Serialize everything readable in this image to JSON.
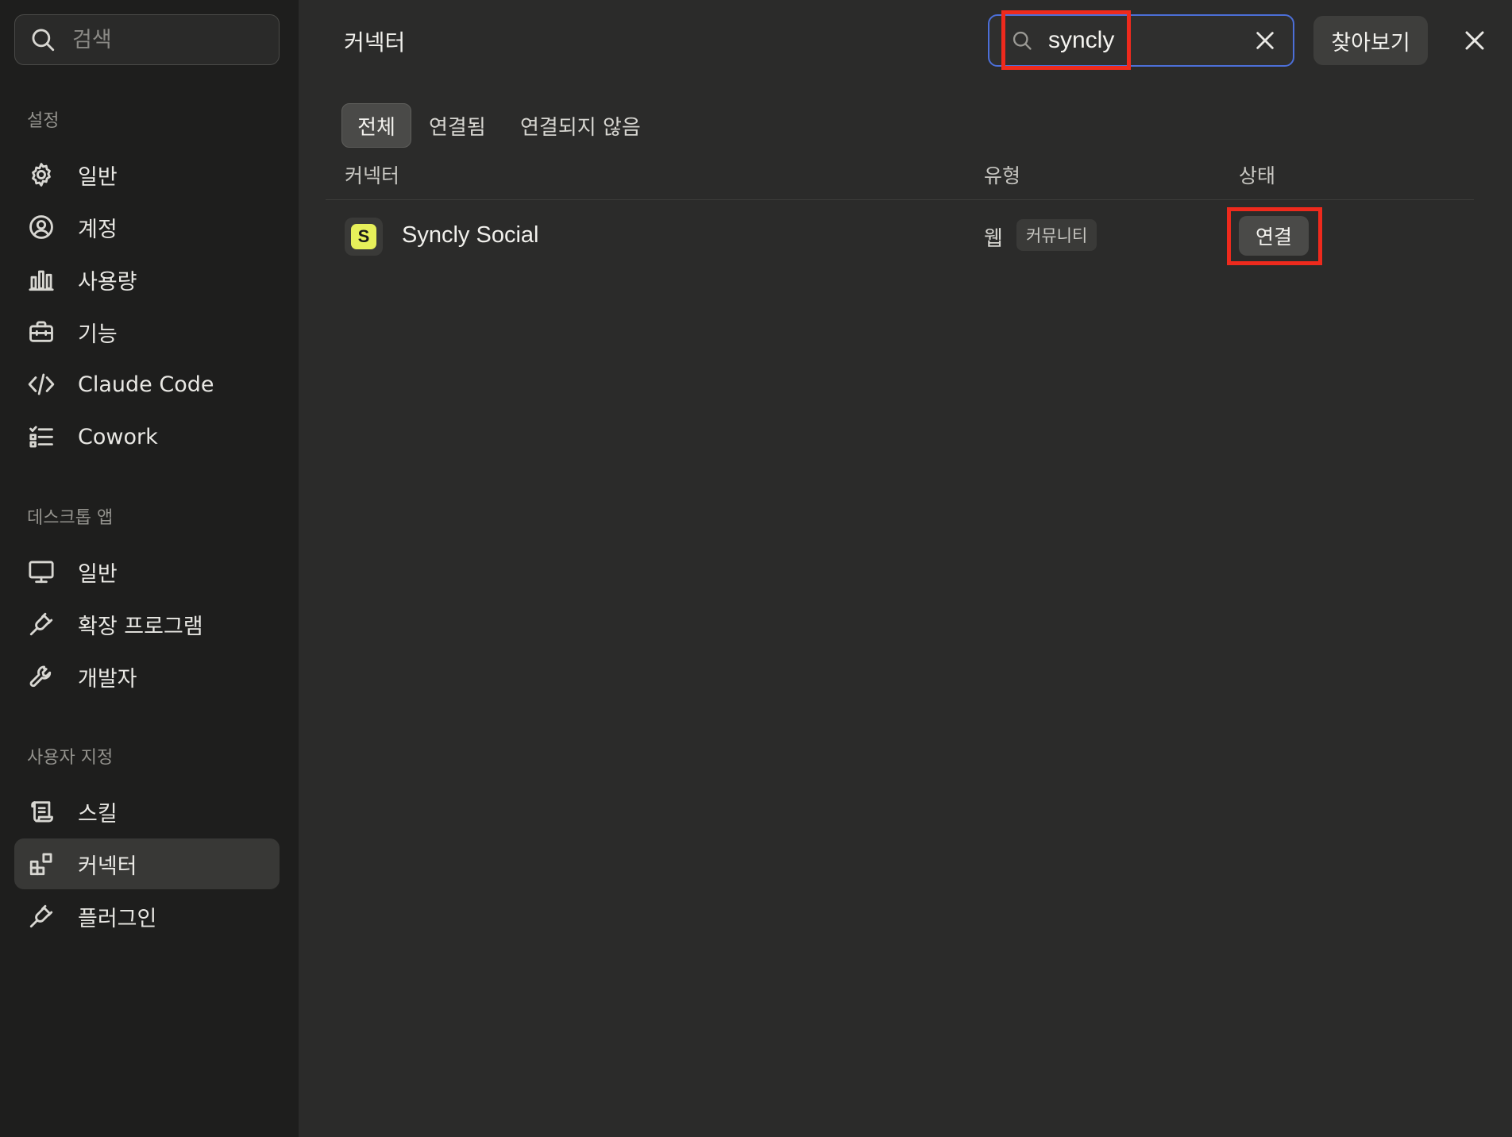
{
  "sidebar": {
    "search_placeholder": "검색",
    "sections": [
      {
        "title": "설정",
        "items": [
          {
            "label": "일반",
            "icon": "gear-icon"
          },
          {
            "label": "계정",
            "icon": "user-circle-icon"
          },
          {
            "label": "사용량",
            "icon": "bar-chart-icon"
          },
          {
            "label": "기능",
            "icon": "briefcase-icon"
          },
          {
            "label": "Claude Code",
            "icon": "code-icon"
          },
          {
            "label": "Cowork",
            "icon": "checklist-icon"
          }
        ]
      },
      {
        "title": "데스크톱 앱",
        "items": [
          {
            "label": "일반",
            "icon": "monitor-icon"
          },
          {
            "label": "확장 프로그램",
            "icon": "plug-icon"
          },
          {
            "label": "개발자",
            "icon": "wrench-icon"
          }
        ]
      },
      {
        "title": "사용자 지정",
        "items": [
          {
            "label": "스킬",
            "icon": "scroll-icon"
          },
          {
            "label": "커넥터",
            "icon": "blocks-icon",
            "active": true
          },
          {
            "label": "플러그인",
            "icon": "plug-icon"
          }
        ]
      }
    ]
  },
  "header": {
    "title": "커넥터",
    "search_value": "syncly",
    "browse_label": "찾아보기"
  },
  "tabs": [
    {
      "label": "전체",
      "active": true
    },
    {
      "label": "연결됨",
      "active": false
    },
    {
      "label": "연결되지 않음",
      "active": false
    }
  ],
  "table": {
    "columns": [
      "커넥터",
      "유형",
      "상태"
    ],
    "rows": [
      {
        "icon_letter": "S",
        "name": "Syncly Social",
        "type": "웹",
        "badge": "커뮤니티",
        "action": "연결"
      }
    ]
  },
  "colors": {
    "accent_focus": "#4c6fd8",
    "highlight": "#ee2a1d",
    "connector_icon": "#e7f05a"
  }
}
